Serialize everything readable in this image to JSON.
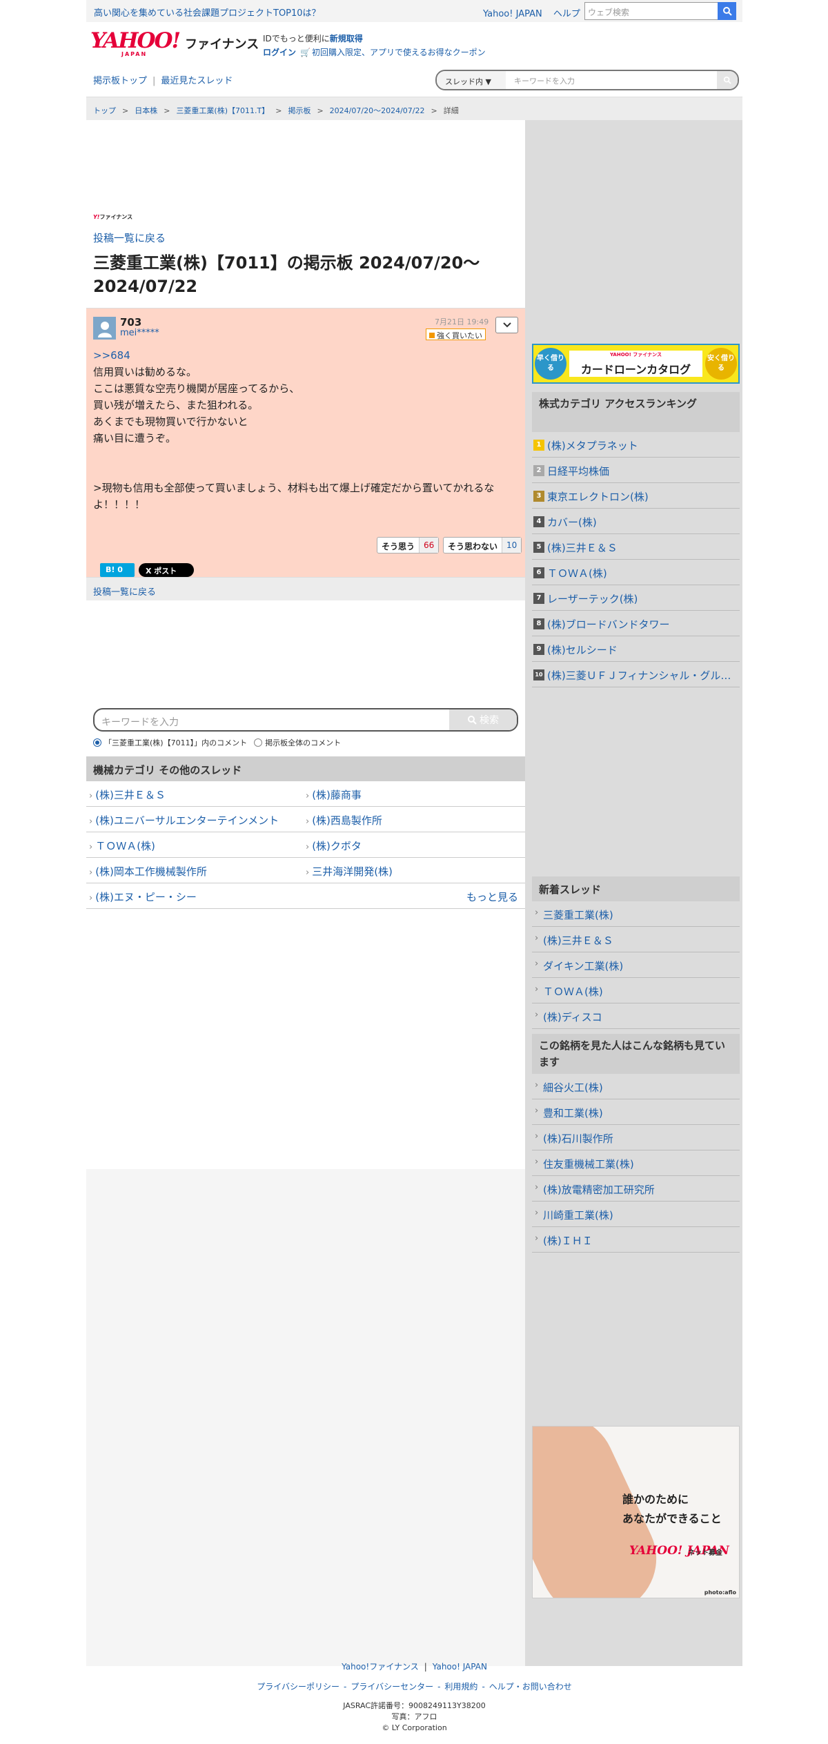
{
  "topbar": {
    "promo": "高い関心を集めている社会課題プロジェクトTOP10は？",
    "yahoo_japan": "Yahoo! JAPAN",
    "help": "ヘルプ",
    "web_search_placeholder": "ウェブ検索"
  },
  "header": {
    "logo_main": "YAHOO!",
    "logo_japan": "JAPAN",
    "logo_sub": "ファイナンス",
    "id_text": "IDでもっと便利に",
    "signup": "新規取得",
    "login": "ログイン",
    "coupon": "初回購入限定、アプリで使えるお得なクーポン"
  },
  "nav": {
    "board_top": "掲示板トップ",
    "recent_threads": "最近見たスレッド",
    "search_scope": "スレッド内",
    "search_placeholder": "キーワードを入力"
  },
  "breadcrumb": [
    "トップ",
    "日本株",
    "三菱重工業(株)【7011.T】",
    "掲示板",
    "2024/07/20〜2024/07/22",
    "詳細"
  ],
  "page": {
    "yf_small": "ファイナンス",
    "back_to_list": "投稿一覧に戻る",
    "title": "三菱重工業(株)【7011】の掲示板 2024/07/20〜2024/07/22"
  },
  "post": {
    "number": "703",
    "user": "mei*****",
    "date": "7月21日 19:49",
    "sentiment": "強く買いたい",
    "reply_to": ">>684",
    "lines": [
      "信用買いは勧めるな。",
      "ここは悪質な空売り機関が居座ってるから、",
      "買い残が増えたら、また狙われる。",
      "あくまでも現物買いで行かないと",
      "痛い目に遭うぞ。",
      "",
      "",
      ">現物も信用も全部使って買いましょう、材料も出て爆上げ確定だから置いてかれるなよ！！！！"
    ],
    "agree_label": "そう思う",
    "agree_count": "66",
    "disagree_label": "そう思わない",
    "disagree_count": "10",
    "hatena": "B! 0",
    "x_post": "X ポスト"
  },
  "lower_search": {
    "placeholder": "キーワードを入力",
    "button": "検索",
    "radio1": "「三菱重工業(株)【7011】」内のコメント",
    "radio2": "掲示板全体のコメント"
  },
  "threads": {
    "header": "機械カテゴリ その他のスレッド",
    "rows": [
      [
        "(株)三井Ｅ＆Ｓ",
        "(株)藤商事"
      ],
      [
        "(株)ユニバーサルエンターテインメント",
        "(株)西島製作所"
      ],
      [
        "ＴＯＷＡ(株)",
        "(株)クボタ"
      ],
      [
        "(株)岡本工作機械製作所",
        "三井海洋開発(株)"
      ],
      [
        "(株)エヌ・ピー・シー",
        ""
      ]
    ],
    "more": "もっと見る"
  },
  "banner": {
    "left": "早く借りる",
    "brand": "YAHOO! ファイナンス",
    "title": "カードローンカタログ",
    "right": "安く借りる"
  },
  "ranking": {
    "header": "株式カテゴリ アクセスランキング",
    "items": [
      {
        "rank": "1",
        "name": "(株)メタプラネット",
        "color": "#f5c400"
      },
      {
        "rank": "2",
        "name": "日経平均株価",
        "color": "#a9a9a9"
      },
      {
        "rank": "3",
        "name": "東京エレクトロン(株)",
        "color": "#b08a2e"
      },
      {
        "rank": "4",
        "name": "カバー(株)",
        "color": "#555555"
      },
      {
        "rank": "5",
        "name": "(株)三井Ｅ＆Ｓ",
        "color": "#555555"
      },
      {
        "rank": "6",
        "name": "ＴＯＷＡ(株)",
        "color": "#555555"
      },
      {
        "rank": "7",
        "name": "レーザーテック(株)",
        "color": "#555555"
      },
      {
        "rank": "8",
        "name": "(株)ブロードバンドタワー",
        "color": "#555555"
      },
      {
        "rank": "9",
        "name": "(株)セルシード",
        "color": "#555555"
      },
      {
        "rank": "10",
        "name": "(株)三菱ＵＦＪフィナンシャル・グループ",
        "color": "#555555"
      }
    ]
  },
  "new_threads": {
    "header": "新着スレッド",
    "items": [
      "三菱重工業(株)",
      "(株)三井Ｅ＆Ｓ",
      "ダイキン工業(株)",
      "ＴＯＷＡ(株)",
      "(株)ディスコ"
    ]
  },
  "also_viewed": {
    "header": "この銘柄を見た人はこんな銘柄も見ています",
    "items": [
      "細谷火工(株)",
      "豊和工業(株)",
      "(株)石川製作所",
      "住友重機械工業(株)",
      "(株)放電精密加工研究所",
      "川崎重工業(株)",
      "(株)ＩＨＩ"
    ]
  },
  "ad2": {
    "line1": "誰かのために",
    "line2": "あなたができること",
    "brand": "YAHOO! JAPAN",
    "service": "ネット募金",
    "photo": "photo:aflo"
  },
  "footer": {
    "link1": "Yahoo!ファイナンス",
    "link2": "Yahoo! JAPAN",
    "links": [
      "プライバシーポリシー",
      "プライバシーセンター",
      "利用規約",
      "ヘルプ・お問い合わせ"
    ],
    "jasrac": "JASRAC許諾番号：9008249113Y38200",
    "photo_credit": "写真：アフロ",
    "copyright": "© LY Corporation"
  }
}
